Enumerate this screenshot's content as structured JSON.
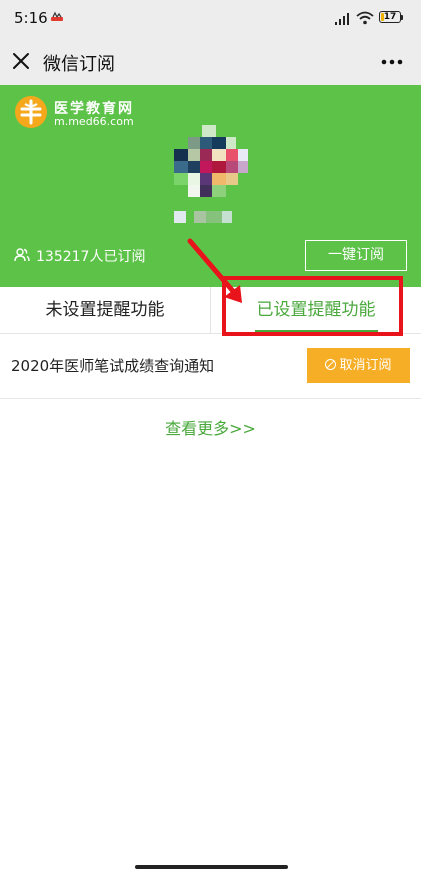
{
  "status_bar": {
    "time": "5:16",
    "battery": "17"
  },
  "title_bar": {
    "title": "微信订阅"
  },
  "header": {
    "logo_title": "医学教育网",
    "logo_sub": "m.med66.com",
    "subscriber_text": "135217人已订阅",
    "one_key_label": "一键订阅"
  },
  "tabs": {
    "unset_label": "未设置提醒功能",
    "set_label": "已设置提醒功能"
  },
  "items": [
    {
      "title": "2020年医师笔试成绩查询通知",
      "action_label": "取消订阅"
    }
  ],
  "more_label": "查看更多>>",
  "colors": {
    "brand_green": "#5dc248",
    "tab_green": "#4aa83c",
    "cancel_orange": "#f6ae26",
    "annotation_red": "#e8131b"
  }
}
